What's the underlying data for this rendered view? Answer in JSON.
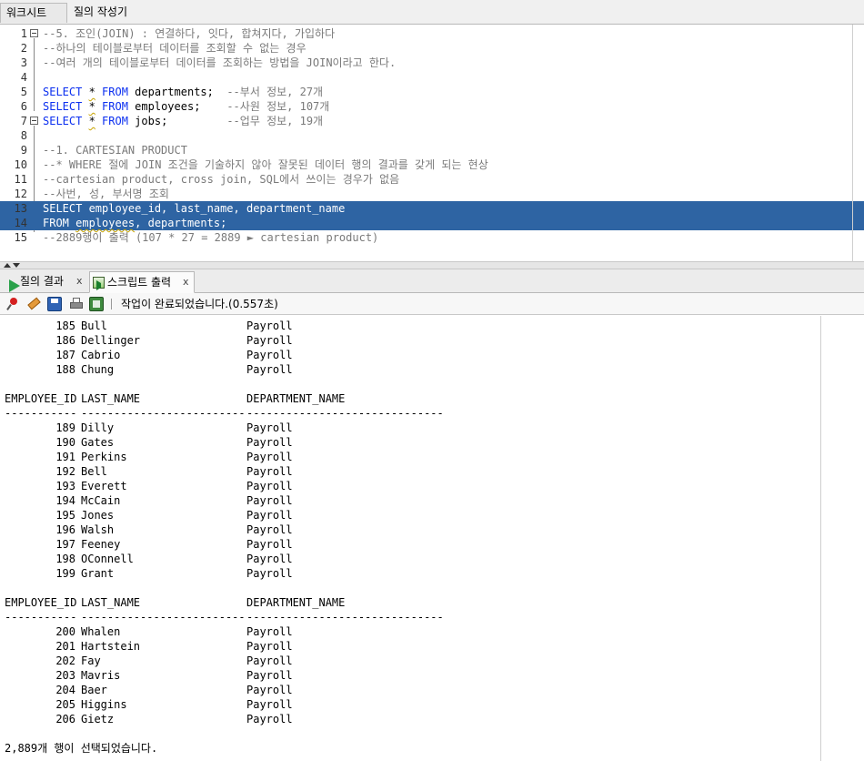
{
  "top_tabs": [
    "워크시트",
    "질의 작성기"
  ],
  "editor": {
    "lines": [
      {
        "n": "1",
        "fold": true,
        "segments": [
          {
            "t": "--5. 조인(JOIN) : 연결하다, 잇다, 합쳐지다, 가입하다",
            "c": "cmt"
          }
        ]
      },
      {
        "n": "2",
        "segments": [
          {
            "t": "--하나의 테이블로부터 데이터를 조회할 수 없는 경우",
            "c": "cmt"
          }
        ]
      },
      {
        "n": "3",
        "segments": [
          {
            "t": "--여러 개의 테이블로부터 데이터를 조회하는 방법을 JOIN이라고 한다.",
            "c": "cmt"
          }
        ]
      },
      {
        "n": "4",
        "segments": []
      },
      {
        "n": "5",
        "segments": [
          {
            "t": "SELECT ",
            "c": "kw"
          },
          {
            "t": "*",
            "c": "sq"
          },
          {
            "t": " FROM ",
            "c": "kw"
          },
          {
            "t": "departments;  ",
            "c": ""
          },
          {
            "t": "--부서 정보, 27개",
            "c": "cmt"
          }
        ]
      },
      {
        "n": "6",
        "segments": [
          {
            "t": "SELECT ",
            "c": "kw"
          },
          {
            "t": "*",
            "c": "sq"
          },
          {
            "t": " FROM ",
            "c": "kw"
          },
          {
            "t": "employees;    ",
            "c": ""
          },
          {
            "t": "--사원 정보, 107개",
            "c": "cmt"
          }
        ]
      },
      {
        "n": "7",
        "fold": true,
        "segments": [
          {
            "t": "SELECT ",
            "c": "kw"
          },
          {
            "t": "*",
            "c": "sq"
          },
          {
            "t": " FROM ",
            "c": "kw"
          },
          {
            "t": "jobs;         ",
            "c": ""
          },
          {
            "t": "--업무 정보, 19개",
            "c": "cmt"
          }
        ]
      },
      {
        "n": "8",
        "segments": []
      },
      {
        "n": "9",
        "segments": [
          {
            "t": "--1. CARTESIAN PRODUCT",
            "c": "cmt"
          }
        ]
      },
      {
        "n": "10",
        "segments": [
          {
            "t": "--* WHERE 절에 JOIN 조건을 기술하지 않아 잘못된 데이터 행의 결과를 갖게 되는 현상",
            "c": "cmt"
          }
        ]
      },
      {
        "n": "11",
        "segments": [
          {
            "t": "--cartesian product, cross join, SQL에서 쓰이는 경우가 없음",
            "c": "cmt"
          }
        ]
      },
      {
        "n": "12",
        "segments": [
          {
            "t": "--사번, 성, 부서명 조회",
            "c": "cmt"
          }
        ]
      },
      {
        "n": "13",
        "hl": true,
        "segments": [
          {
            "t": "SELECT employee_id, last_name, department_name",
            "c": ""
          }
        ]
      },
      {
        "n": "14",
        "hl": true,
        "segments": [
          {
            "t": "FROM ",
            "c": ""
          },
          {
            "t": "employees",
            "c": "sq"
          },
          {
            "t": ", departments;",
            "c": ""
          }
        ]
      },
      {
        "n": "15",
        "segments": [
          {
            "t": "--2889행이 출력 (107 * 27 = 2889 ► cartesian product)",
            "c": "cmt"
          }
        ]
      }
    ]
  },
  "output_tabs": [
    {
      "label": "질의 결과",
      "icon": "play-icon"
    },
    {
      "label": "스크립트 출력",
      "icon": "script-icon"
    }
  ],
  "toolbar": {
    "status": "작업이 완료되었습니다.(0.557초)"
  },
  "output": {
    "columns": [
      "EMPLOYEE_ID",
      "LAST_NAME",
      "DEPARTMENT_NAME"
    ],
    "dashes": [
      "-----------",
      "-------------------------",
      "------------------------------"
    ],
    "blocks": [
      {
        "header": false,
        "rows": [
          [
            "185",
            "Bull",
            "Payroll"
          ],
          [
            "186",
            "Dellinger",
            "Payroll"
          ],
          [
            "187",
            "Cabrio",
            "Payroll"
          ],
          [
            "188",
            "Chung",
            "Payroll"
          ]
        ]
      },
      {
        "header": true,
        "rows": [
          [
            "189",
            "Dilly",
            "Payroll"
          ],
          [
            "190",
            "Gates",
            "Payroll"
          ],
          [
            "191",
            "Perkins",
            "Payroll"
          ],
          [
            "192",
            "Bell",
            "Payroll"
          ],
          [
            "193",
            "Everett",
            "Payroll"
          ],
          [
            "194",
            "McCain",
            "Payroll"
          ],
          [
            "195",
            "Jones",
            "Payroll"
          ],
          [
            "196",
            "Walsh",
            "Payroll"
          ],
          [
            "197",
            "Feeney",
            "Payroll"
          ],
          [
            "198",
            "OConnell",
            "Payroll"
          ],
          [
            "199",
            "Grant",
            "Payroll"
          ]
        ]
      },
      {
        "header": true,
        "rows": [
          [
            "200",
            "Whalen",
            "Payroll"
          ],
          [
            "201",
            "Hartstein",
            "Payroll"
          ],
          [
            "202",
            "Fay",
            "Payroll"
          ],
          [
            "203",
            "Mavris",
            "Payroll"
          ],
          [
            "204",
            "Baer",
            "Payroll"
          ],
          [
            "205",
            "Higgins",
            "Payroll"
          ],
          [
            "206",
            "Gietz",
            "Payroll"
          ]
        ]
      }
    ],
    "footer": "2,889개 행이 선택되었습니다."
  }
}
